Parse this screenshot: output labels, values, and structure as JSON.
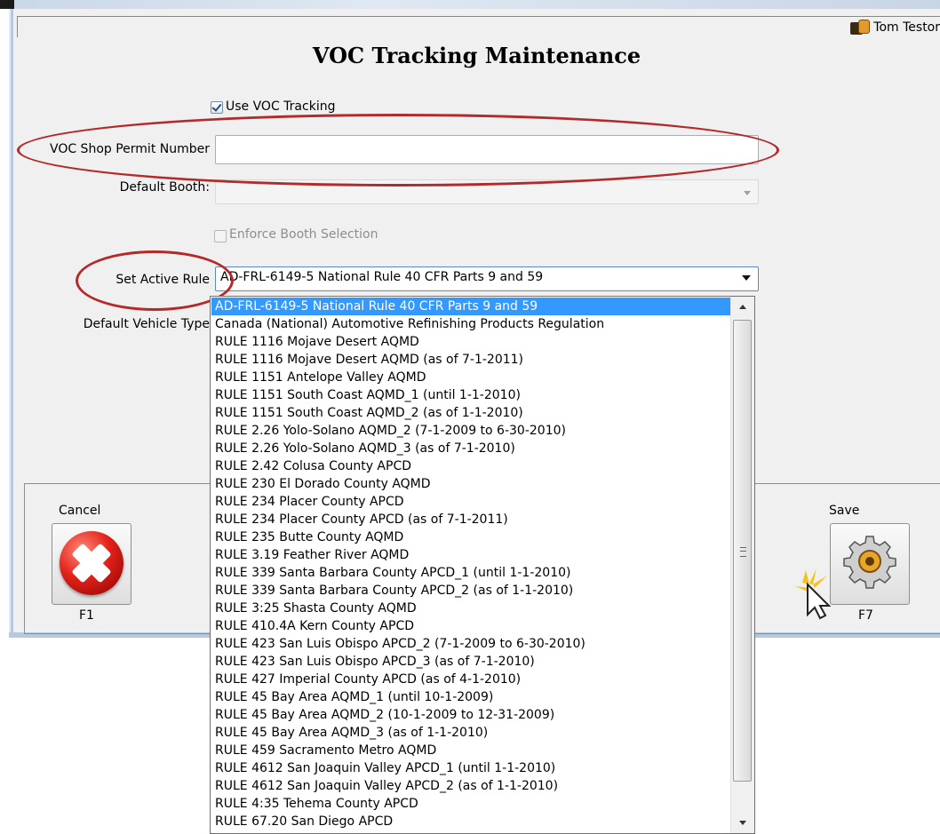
{
  "user": {
    "name": "Tom Testor",
    "icon": "user-profile-icon"
  },
  "page": {
    "title": "VOC Tracking Maintenance"
  },
  "form": {
    "use_voc_tracking": {
      "label": "Use VOC Tracking",
      "checked": true
    },
    "permit_number": {
      "label": "VOC Shop Permit Number",
      "value": ""
    },
    "default_booth": {
      "label": "Default Booth:",
      "value": ""
    },
    "enforce_booth": {
      "label": "Enforce Booth Selection",
      "checked": false,
      "disabled": true
    },
    "active_rule": {
      "label": "Set Active Rule",
      "value": "AD-FRL-6149-5 National Rule 40 CFR Parts 9 and 59"
    },
    "default_vehicle_type": {
      "label": "Default Vehicle Type"
    }
  },
  "buttons": {
    "cancel": {
      "label": "Cancel",
      "key": "F1",
      "icon": "cancel-x-icon"
    },
    "save": {
      "label": "Save",
      "key": "F7",
      "icon": "gear-icon"
    }
  },
  "dropdown": {
    "selected_index": 0,
    "options": [
      "AD-FRL-6149-5 National Rule 40 CFR Parts 9 and 59",
      "Canada (National) Automotive Refinishing Products Regulation",
      "RULE 1116 Mojave Desert AQMD",
      "RULE 1116 Mojave Desert AQMD (as of 7-1-2011)",
      "RULE 1151 Antelope Valley AQMD",
      "RULE 1151 South Coast AQMD_1 (until 1-1-2010)",
      "RULE 1151 South Coast AQMD_2 (as of 1-1-2010)",
      "RULE 2.26 Yolo-Solano AQMD_2 (7-1-2009 to 6-30-2010)",
      "RULE 2.26 Yolo-Solano AQMD_3 (as of 7-1-2010)",
      "RULE 2.42 Colusa County APCD",
      "RULE 230 El Dorado County AQMD",
      "RULE 234 Placer County APCD",
      "RULE 234 Placer County APCD (as of 7-1-2011)",
      "RULE 235 Butte County AQMD",
      "RULE 3.19 Feather River AQMD",
      "RULE 339 Santa Barbara County APCD_1 (until 1-1-2010)",
      "RULE 339 Santa Barbara County APCD_2 (as of 1-1-2010)",
      "RULE 3:25 Shasta County AQMD",
      "RULE 410.4A Kern County APCD",
      "RULE 423 San Luis Obispo APCD_2 (7-1-2009 to 6-30-2010)",
      "RULE 423 San Luis Obispo APCD_3 (as of 7-1-2010)",
      "RULE 427 Imperial County APCD (as of 4-1-2010)",
      "RULE 45 Bay Area AQMD_1 (until 10-1-2009)",
      "RULE 45 Bay Area AQMD_2 (10-1-2009 to 12-31-2009)",
      "RULE 45 Bay Area AQMD_3 (as of 1-1-2010)",
      "RULE 459 Sacramento Metro AQMD",
      "RULE 4612 San Joaquin Valley APCD_1 (until 1-1-2010)",
      "RULE 4612 San Joaquin Valley APCD_2 (as of 1-1-2010)",
      "RULE 4:35 Tehema County APCD",
      "RULE 67.20 San Diego APCD"
    ]
  },
  "colors": {
    "highlight": "#3399ff",
    "annotation_red": "#b42a2a",
    "window_bg": "#f0f0f0"
  }
}
